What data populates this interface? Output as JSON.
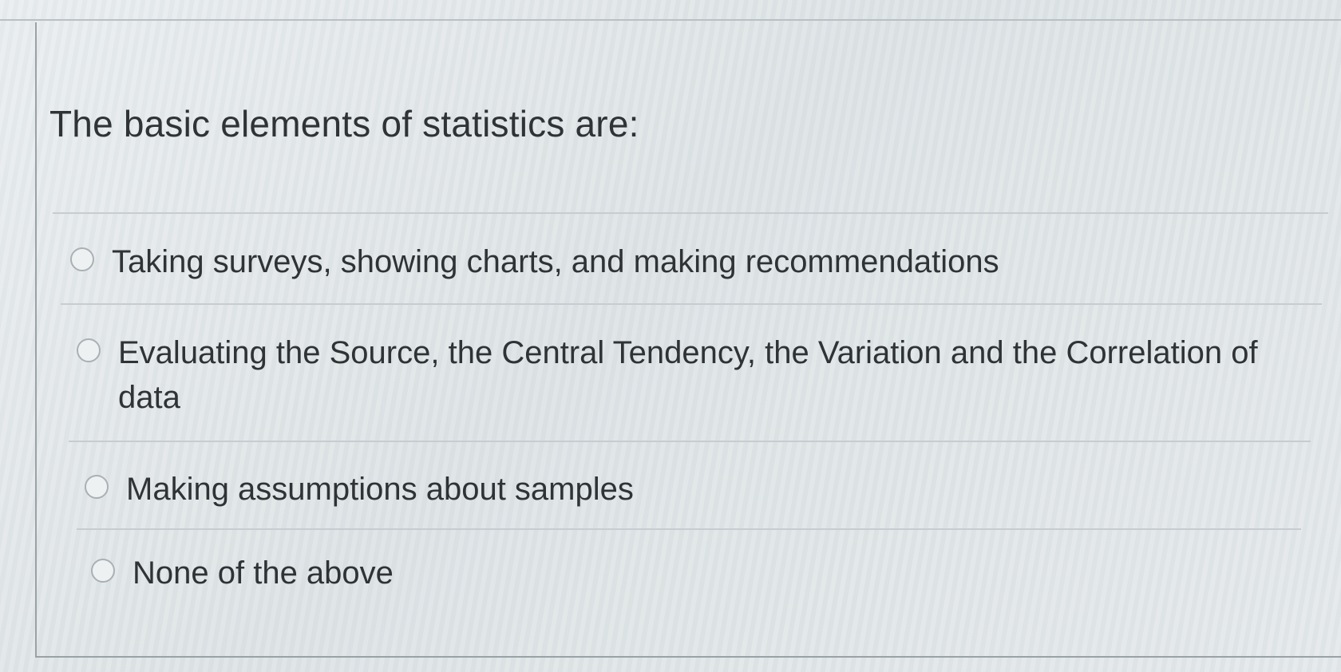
{
  "question": {
    "text": "The basic elements of statistics are:"
  },
  "options": [
    {
      "label": "Taking surveys, showing charts, and making recommendations",
      "selected": false
    },
    {
      "label": "Evaluating the Source, the Central Tendency, the Variation and the Correlation of data",
      "selected": false
    },
    {
      "label": "Making assumptions about samples",
      "selected": false
    },
    {
      "label": "None of the above",
      "selected": false
    }
  ],
  "icons": {
    "radio": "radio-button-icon"
  }
}
